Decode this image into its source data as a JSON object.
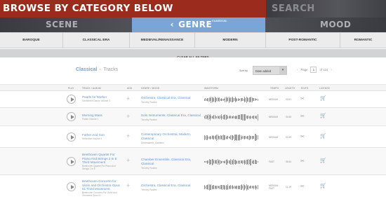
{
  "banner": {
    "title": "BROWSE BY CATEGORY BELOW",
    "search_label": "SEARCH"
  },
  "categories": {
    "scene": "SCENE",
    "genre": "GENRE",
    "genre_sup": "CLASSICAL",
    "mood": "MOOD"
  },
  "subgenres": [
    "BAROQUE",
    "CLASSICAL ERA",
    "MEDIEVAL/RENAISSANCE",
    "MODERN",
    "POST-ROMANTIC",
    "ROMANTIC"
  ],
  "clear_filters": "CLEAR ALL FILTERS",
  "tracks_header": {
    "genre": "Classical",
    "label": "Tracks",
    "sort_by_label": "Sort by",
    "sort_value": "Date added",
    "page_label": "Page",
    "page_number": "1",
    "page_of": "of 124"
  },
  "columns": [
    "PLAY",
    "TRACK / ALBUM",
    "ADD",
    "GENRE / MOOD",
    "WAVEFORM",
    "TEMPO",
    "LENGTH",
    "EDITS",
    "LICENSE"
  ],
  "tracks": [
    {
      "title": "Pearls for Mother",
      "album": "Gentlemen Dance Volume 3",
      "genre": "Orchestra, Classical Era, Classical",
      "author": "Timothy Pauline",
      "tempo": "MEDIUM",
      "length": "03:51"
    },
    {
      "title": "Morning Mass",
      "album": "Praise Volume 1",
      "genre": "Solo Instruments, Classical Era, Classical",
      "author": "Timothy Pauline",
      "tempo": "MEDIUM",
      "length": "02:45"
    },
    {
      "title": "Father And Son",
      "album": "Reflective Volume 4",
      "genre": "Contemporary Orchestral, Modern, Classical",
      "author": "Dreamdance_Saddeen",
      "tempo": "MEDIUM",
      "length": "03:39"
    },
    {
      "title": "Beethoven Quartet For Piano And Strings 2 In E Third Movement",
      "album": "Beethoven Quartet For Piano And Strings 2 In E",
      "genre": "Chamber Ensemble, Classical Era, Classical",
      "author": "Timothy Pauline",
      "tempo": "FAST",
      "length": "05:34"
    },
    {
      "title": "Beethoven Concerto for Violin and Orchestra Opus 61 Third Movement",
      "album": "Beethoven Concerto For Violin And Orchestra Opus 61",
      "genre": "Orchestra, Classical Era, Classical",
      "author": "Timothy Pauline",
      "tempo": "MEDIUM - FAST",
      "length": "11:19"
    }
  ],
  "icons": {
    "play": "play-icon",
    "add": "plus-icon",
    "edits": "scissors-icon",
    "license": "cart-icon",
    "chevron": "chevron-left-icon"
  },
  "colors": {
    "banner": "#9a2b1d",
    "accent": "#7aa6d7",
    "link": "#5f93cc"
  }
}
